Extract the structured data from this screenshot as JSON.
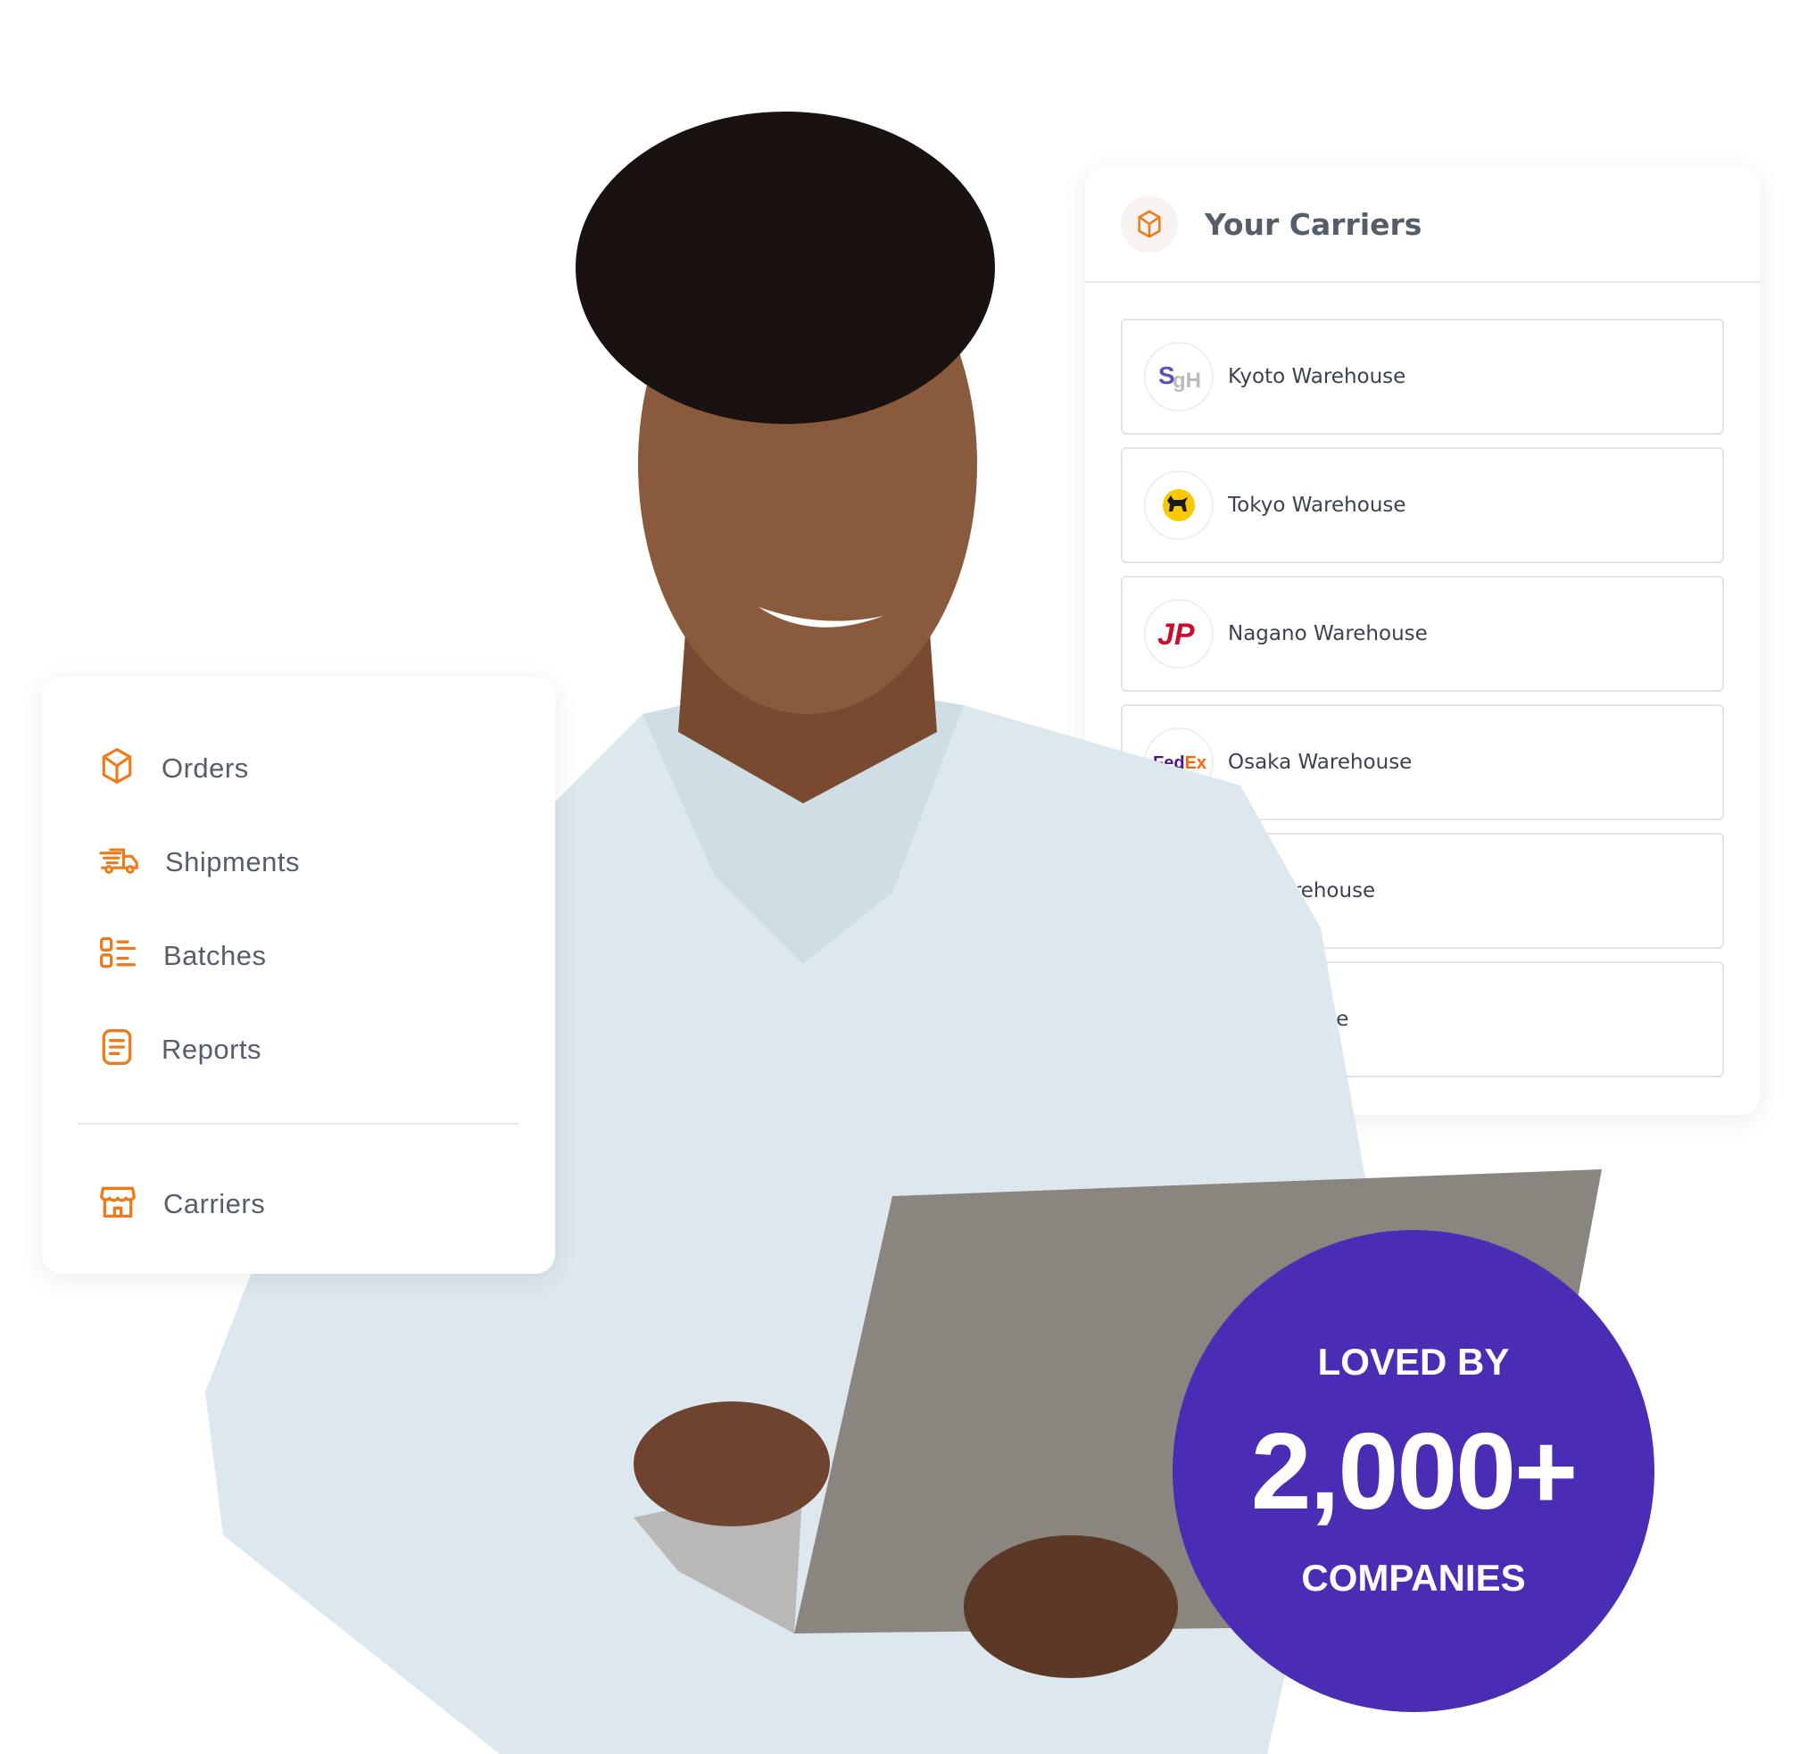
{
  "carriers_panel": {
    "title": "Your Carriers",
    "icon": "box-icon",
    "rows": [
      {
        "label": "Kyoto Warehouse",
        "logo": "sgh-logo"
      },
      {
        "label": "Tokyo Warehouse",
        "logo": "yamato-cat-logo"
      },
      {
        "label": "Nagano Warehouse",
        "logo": "japan-post-logo"
      },
      {
        "label": "Osaka Warehouse",
        "logo": "fedex-logo"
      },
      {
        "label": "o Warehouse",
        "logo": "hidden"
      },
      {
        "label": "house",
        "logo": "hidden"
      }
    ]
  },
  "sidebar": {
    "items": [
      {
        "label": "Orders",
        "icon": "box-icon"
      },
      {
        "label": "Shipments",
        "icon": "truck-icon"
      },
      {
        "label": "Batches",
        "icon": "list-icon"
      },
      {
        "label": "Reports",
        "icon": "document-icon"
      },
      {
        "label": "Carriers",
        "icon": "store-icon"
      }
    ]
  },
  "badge": {
    "line1": "LOVED BY",
    "line2": "2,000+",
    "line3": "COMPANIES"
  },
  "colors": {
    "accent": "#f07a1a",
    "badge": "#4a2db4",
    "text": "#565f69"
  }
}
